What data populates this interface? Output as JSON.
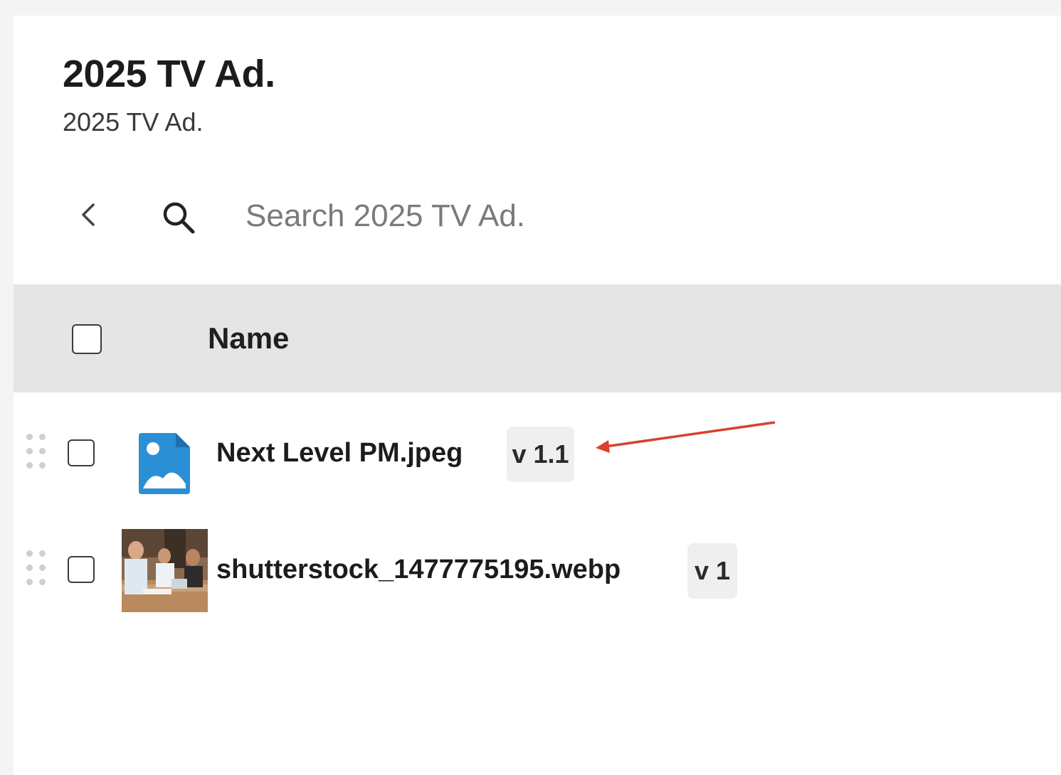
{
  "page": {
    "title": "2025 TV Ad.",
    "subtitle": "2025 TV Ad."
  },
  "toolbar": {
    "back_icon": "chevron-left-icon",
    "search_icon": "search-icon",
    "search_placeholder": "Search 2025 TV Ad."
  },
  "table": {
    "columns": [
      "Name"
    ],
    "rows": [
      {
        "name": "Next Level PM.jpeg",
        "version": "v 1.1",
        "icon": "image-file-icon",
        "icon_color": "#2b8fd6"
      },
      {
        "name": "shutterstock_1477775195.webp",
        "version": "v 1",
        "icon": "image-thumbnail"
      }
    ]
  },
  "annotation": {
    "color": "#d9412e"
  }
}
